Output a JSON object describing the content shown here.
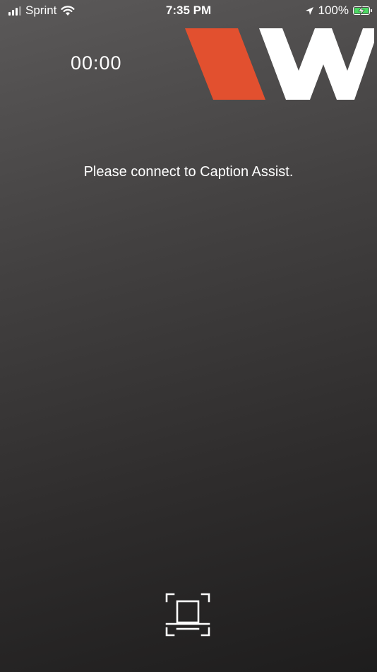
{
  "status_bar": {
    "carrier": "Sprint",
    "time": "7:35 PM",
    "battery_percent": "100%",
    "signal_icon": "cellular-signal-icon",
    "wifi_icon": "wifi-icon",
    "location_icon": "location-arrow-icon",
    "battery_icon": "battery-charging-icon",
    "battery_color": "#4cd964"
  },
  "main": {
    "timer": "00:00",
    "message": "Please connect to Caption Assist.",
    "logo_icon": "brand-logo-icon",
    "logo_accent_color": "#e2502f",
    "scan_icon": "scan-document-icon"
  }
}
